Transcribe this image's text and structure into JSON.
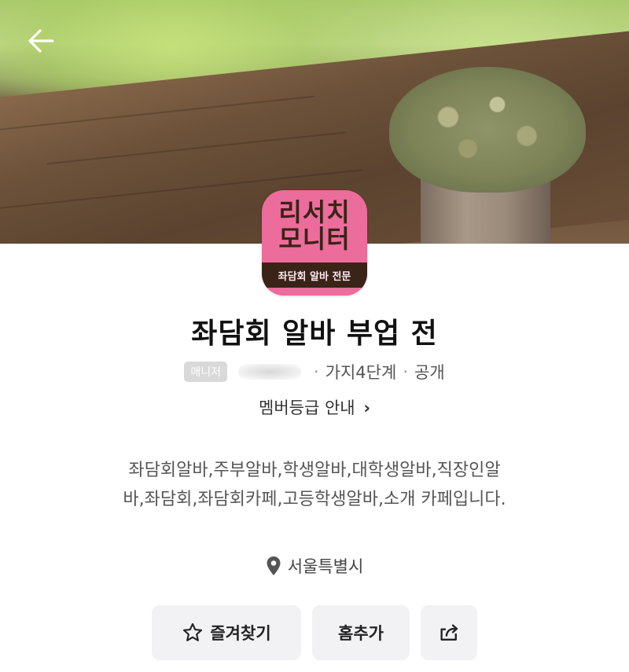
{
  "header": {
    "back_icon": "arrow-left-icon"
  },
  "logo": {
    "line1": "리서치",
    "line2": "모니터",
    "tagline": "좌담회 알바 전문",
    "colors": {
      "pink": "#ec6c9b",
      "brown": "#3a2418"
    }
  },
  "cafe": {
    "title": "좌담회 알바 부업 전",
    "manager_badge": "매니저",
    "level": "가지4단계",
    "visibility": "공개",
    "member_grade_link": "멤버등급 안내",
    "member_grade_chevron": "›",
    "description": "좌담회알바,주부알바,학생알바,대학생알바,직장인알바,좌담회,좌담회카페,고등학생알바,소개 카페입니다.",
    "location": "서울특별시",
    "location_icon": "map-pin-icon"
  },
  "actions": {
    "favorite_label": "즐겨찾기",
    "favorite_icon": "star-icon",
    "home_add_label": "홈추가",
    "share_icon": "share-icon"
  },
  "separator": "·"
}
